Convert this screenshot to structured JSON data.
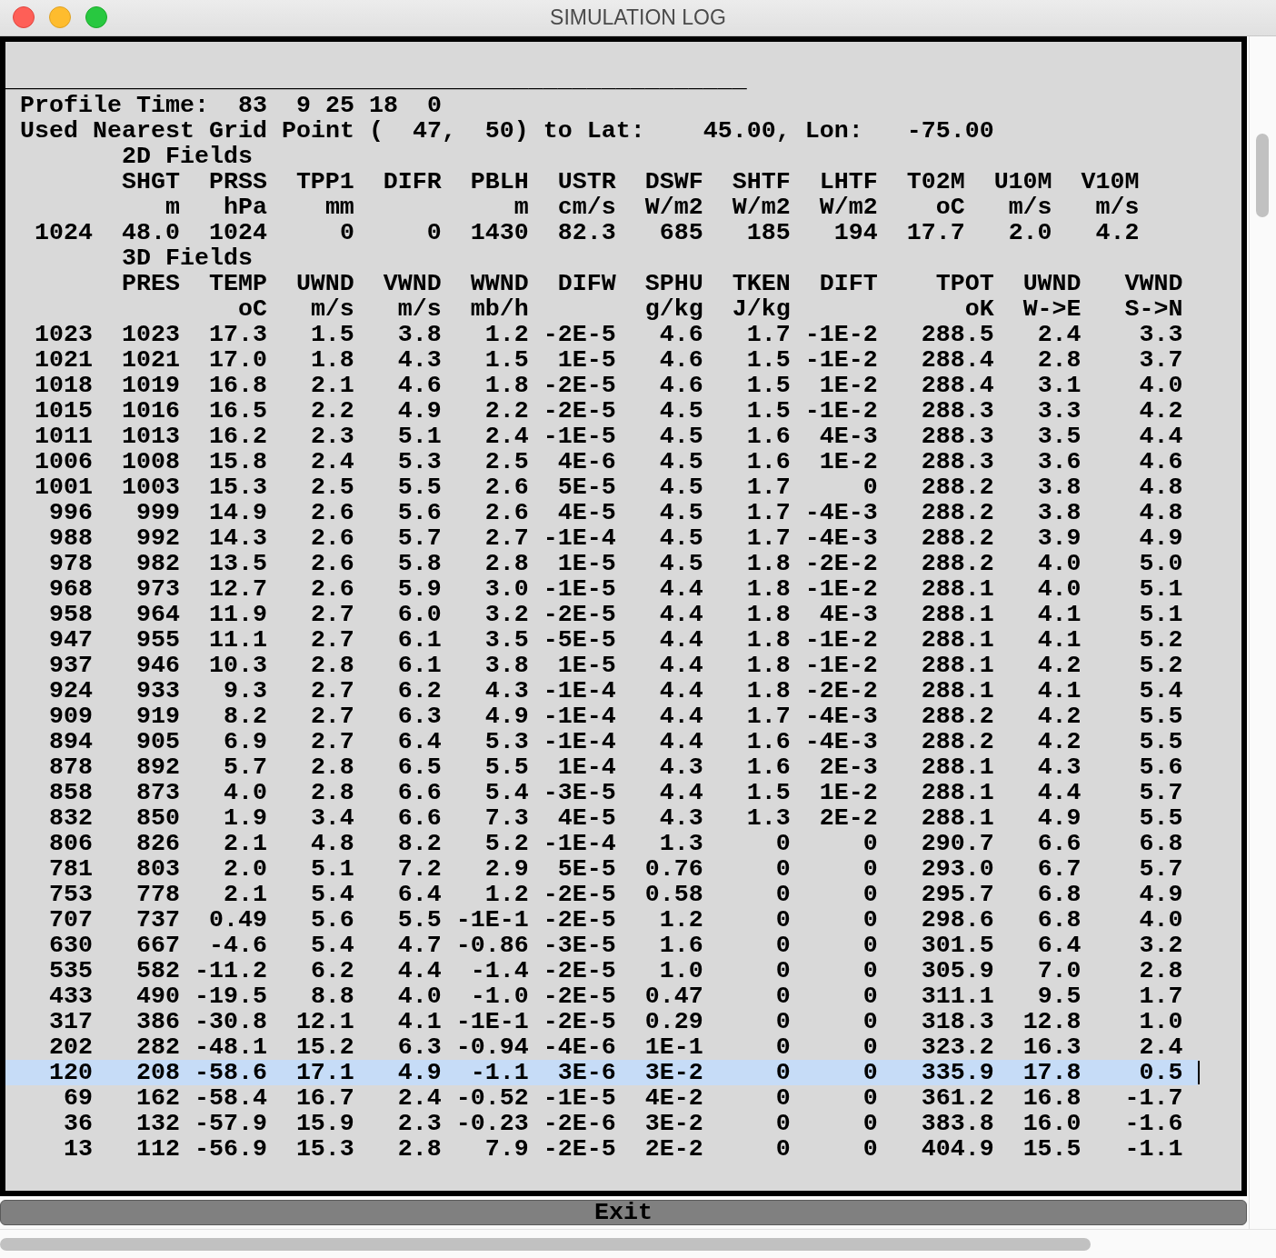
{
  "window": {
    "title": "SIMULATION LOG"
  },
  "log": {
    "rule": "___________________________________________________",
    "lines": [
      "Profile Time:  83  9 25 18  0",
      "Used Nearest Grid Point (  47,  50) to Lat:    45.00, Lon:   -75.00"
    ],
    "sections": [
      {
        "kind": "surface",
        "title": "2D Fields",
        "columns": [
          {},
          {
            "name": "SHGT",
            "unit": "m"
          },
          {
            "name": "PRSS",
            "unit": "hPa"
          },
          {
            "name": "TPP1",
            "unit": "mm"
          },
          {
            "name": "DIFR"
          },
          {
            "name": "PBLH",
            "unit": "m"
          },
          {
            "name": "USTR",
            "unit": "cm/s"
          },
          {
            "name": "DSWF",
            "unit": "W/m2"
          },
          {
            "name": "SHTF",
            "unit": "W/m2"
          },
          {
            "name": "LHTF",
            "unit": "W/m2"
          },
          {
            "name": "T02M",
            "unit": "oC"
          },
          {
            "name": "U10M",
            "unit": "m/s"
          },
          {
            "name": "V10M",
            "unit": "m/s"
          }
        ],
        "rows": [
          {
            "cells": [
              "1024",
              "48.0",
              "1024",
              "0",
              "0",
              "1430",
              "82.3",
              "685",
              "185",
              "194",
              "17.7",
              "2.0",
              "4.2"
            ],
            "selected": false
          }
        ]
      },
      {
        "kind": "profile",
        "title": "3D Fields",
        "columns": [
          {},
          {
            "name": "PRES"
          },
          {
            "name": "TEMP",
            "unit": "oC"
          },
          {
            "name": "UWND",
            "unit": "m/s"
          },
          {
            "name": "VWND",
            "unit": "m/s"
          },
          {
            "name": "WWND",
            "unit": "mb/h"
          },
          {
            "name": "DIFW"
          },
          {
            "name": "SPHU",
            "unit": "g/kg"
          },
          {
            "name": "TKEN",
            "unit": "J/kg"
          },
          {
            "name": "DIFT"
          },
          {
            "name": "TPOT",
            "unit": "oK"
          },
          {
            "name": "UWND",
            "unit": "W->E"
          },
          {
            "name": "VWND",
            "unit": "S->N"
          }
        ],
        "rows": [
          {
            "cells": [
              "1023",
              "1023",
              "17.3",
              "1.5",
              "3.8",
              "1.2",
              "-2E-5",
              "4.6",
              "1.7",
              "-1E-2",
              "288.5",
              "2.4",
              "3.3"
            ],
            "selected": false
          },
          {
            "cells": [
              "1021",
              "1021",
              "17.0",
              "1.8",
              "4.3",
              "1.5",
              "1E-5",
              "4.6",
              "1.5",
              "-1E-2",
              "288.4",
              "2.8",
              "3.7"
            ],
            "selected": false
          },
          {
            "cells": [
              "1018",
              "1019",
              "16.8",
              "2.1",
              "4.6",
              "1.8",
              "-2E-5",
              "4.6",
              "1.5",
              "1E-2",
              "288.4",
              "3.1",
              "4.0"
            ],
            "selected": false
          },
          {
            "cells": [
              "1015",
              "1016",
              "16.5",
              "2.2",
              "4.9",
              "2.2",
              "-2E-5",
              "4.5",
              "1.5",
              "-1E-2",
              "288.3",
              "3.3",
              "4.2"
            ],
            "selected": false
          },
          {
            "cells": [
              "1011",
              "1013",
              "16.2",
              "2.3",
              "5.1",
              "2.4",
              "-1E-5",
              "4.5",
              "1.6",
              "4E-3",
              "288.3",
              "3.5",
              "4.4"
            ],
            "selected": false
          },
          {
            "cells": [
              "1006",
              "1008",
              "15.8",
              "2.4",
              "5.3",
              "2.5",
              "4E-6",
              "4.5",
              "1.6",
              "1E-2",
              "288.3",
              "3.6",
              "4.6"
            ],
            "selected": false
          },
          {
            "cells": [
              "1001",
              "1003",
              "15.3",
              "2.5",
              "5.5",
              "2.6",
              "5E-5",
              "4.5",
              "1.7",
              "0",
              "288.2",
              "3.8",
              "4.8"
            ],
            "selected": false
          },
          {
            "cells": [
              "996",
              "999",
              "14.9",
              "2.6",
              "5.6",
              "2.6",
              "4E-5",
              "4.5",
              "1.7",
              "-4E-3",
              "288.2",
              "3.8",
              "4.8"
            ],
            "selected": false
          },
          {
            "cells": [
              "988",
              "992",
              "14.3",
              "2.6",
              "5.7",
              "2.7",
              "-1E-4",
              "4.5",
              "1.7",
              "-4E-3",
              "288.2",
              "3.9",
              "4.9"
            ],
            "selected": false
          },
          {
            "cells": [
              "978",
              "982",
              "13.5",
              "2.6",
              "5.8",
              "2.8",
              "1E-5",
              "4.5",
              "1.8",
              "-2E-2",
              "288.2",
              "4.0",
              "5.0"
            ],
            "selected": false
          },
          {
            "cells": [
              "968",
              "973",
              "12.7",
              "2.6",
              "5.9",
              "3.0",
              "-1E-5",
              "4.4",
              "1.8",
              "-1E-2",
              "288.1",
              "4.0",
              "5.1"
            ],
            "selected": false
          },
          {
            "cells": [
              "958",
              "964",
              "11.9",
              "2.7",
              "6.0",
              "3.2",
              "-2E-5",
              "4.4",
              "1.8",
              "4E-3",
              "288.1",
              "4.1",
              "5.1"
            ],
            "selected": false
          },
          {
            "cells": [
              "947",
              "955",
              "11.1",
              "2.7",
              "6.1",
              "3.5",
              "-5E-5",
              "4.4",
              "1.8",
              "-1E-2",
              "288.1",
              "4.1",
              "5.2"
            ],
            "selected": false
          },
          {
            "cells": [
              "937",
              "946",
              "10.3",
              "2.8",
              "6.1",
              "3.8",
              "1E-5",
              "4.4",
              "1.8",
              "-1E-2",
              "288.1",
              "4.2",
              "5.2"
            ],
            "selected": false
          },
          {
            "cells": [
              "924",
              "933",
              "9.3",
              "2.7",
              "6.2",
              "4.3",
              "-1E-4",
              "4.4",
              "1.8",
              "-2E-2",
              "288.1",
              "4.1",
              "5.4"
            ],
            "selected": false
          },
          {
            "cells": [
              "909",
              "919",
              "8.2",
              "2.7",
              "6.3",
              "4.9",
              "-1E-4",
              "4.4",
              "1.7",
              "-4E-3",
              "288.2",
              "4.2",
              "5.5"
            ],
            "selected": false
          },
          {
            "cells": [
              "894",
              "905",
              "6.9",
              "2.7",
              "6.4",
              "5.3",
              "-1E-4",
              "4.4",
              "1.6",
              "-4E-3",
              "288.2",
              "4.2",
              "5.5"
            ],
            "selected": false
          },
          {
            "cells": [
              "878",
              "892",
              "5.7",
              "2.8",
              "6.5",
              "5.5",
              "1E-4",
              "4.3",
              "1.6",
              "2E-3",
              "288.1",
              "4.3",
              "5.6"
            ],
            "selected": false
          },
          {
            "cells": [
              "858",
              "873",
              "4.0",
              "2.8",
              "6.6",
              "5.4",
              "-3E-5",
              "4.4",
              "1.5",
              "1E-2",
              "288.1",
              "4.4",
              "5.7"
            ],
            "selected": false
          },
          {
            "cells": [
              "832",
              "850",
              "1.9",
              "3.4",
              "6.6",
              "7.3",
              "4E-5",
              "4.3",
              "1.3",
              "2E-2",
              "288.1",
              "4.9",
              "5.5"
            ],
            "selected": false
          },
          {
            "cells": [
              "806",
              "826",
              "2.1",
              "4.8",
              "8.2",
              "5.2",
              "-1E-4",
              "1.3",
              "0",
              "0",
              "290.7",
              "6.6",
              "6.8"
            ],
            "selected": false
          },
          {
            "cells": [
              "781",
              "803",
              "2.0",
              "5.1",
              "7.2",
              "2.9",
              "5E-5",
              "0.76",
              "0",
              "0",
              "293.0",
              "6.7",
              "5.7"
            ],
            "selected": false
          },
          {
            "cells": [
              "753",
              "778",
              "2.1",
              "5.4",
              "6.4",
              "1.2",
              "-2E-5",
              "0.58",
              "0",
              "0",
              "295.7",
              "6.8",
              "4.9"
            ],
            "selected": false
          },
          {
            "cells": [
              "707",
              "737",
              "0.49",
              "5.6",
              "5.5",
              "-1E-1",
              "-2E-5",
              "1.2",
              "0",
              "0",
              "298.6",
              "6.8",
              "4.0"
            ],
            "selected": false
          },
          {
            "cells": [
              "630",
              "667",
              "-4.6",
              "5.4",
              "4.7",
              "-0.86",
              "-3E-5",
              "1.6",
              "0",
              "0",
              "301.5",
              "6.4",
              "3.2"
            ],
            "selected": false
          },
          {
            "cells": [
              "535",
              "582",
              "-11.2",
              "6.2",
              "4.4",
              "-1.4",
              "-2E-5",
              "1.0",
              "0",
              "0",
              "305.9",
              "7.0",
              "2.8"
            ],
            "selected": false
          },
          {
            "cells": [
              "433",
              "490",
              "-19.5",
              "8.8",
              "4.0",
              "-1.0",
              "-2E-5",
              "0.47",
              "0",
              "0",
              "311.1",
              "9.5",
              "1.7"
            ],
            "selected": false
          },
          {
            "cells": [
              "317",
              "386",
              "-30.8",
              "12.1",
              "4.1",
              "-1E-1",
              "-2E-5",
              "0.29",
              "0",
              "0",
              "318.3",
              "12.8",
              "1.0"
            ],
            "selected": false
          },
          {
            "cells": [
              "202",
              "282",
              "-48.1",
              "15.2",
              "6.3",
              "-0.94",
              "-4E-6",
              "1E-1",
              "0",
              "0",
              "323.2",
              "16.3",
              "2.4"
            ],
            "selected": false
          },
          {
            "cells": [
              "120",
              "208",
              "-58.6",
              "17.1",
              "4.9",
              "-1.1",
              "3E-6",
              "3E-2",
              "0",
              "0",
              "335.9",
              "17.8",
              "0.5"
            ],
            "selected": true
          },
          {
            "cells": [
              "69",
              "162",
              "-58.4",
              "16.7",
              "2.4",
              "-0.52",
              "-1E-5",
              "4E-2",
              "0",
              "0",
              "361.2",
              "16.8",
              "-1.7"
            ],
            "selected": false
          },
          {
            "cells": [
              "36",
              "132",
              "-57.9",
              "15.9",
              "2.3",
              "-0.23",
              "-2E-6",
              "3E-2",
              "0",
              "0",
              "383.8",
              "16.0",
              "-1.6"
            ],
            "selected": false
          },
          {
            "cells": [
              "13",
              "112",
              "-56.9",
              "15.3",
              "2.8",
              "7.9",
              "-2E-5",
              "2E-2",
              "0",
              "0",
              "404.9",
              "15.5",
              "-1.1"
            ],
            "selected": false
          }
        ]
      }
    ]
  },
  "exit_button": "Exit"
}
